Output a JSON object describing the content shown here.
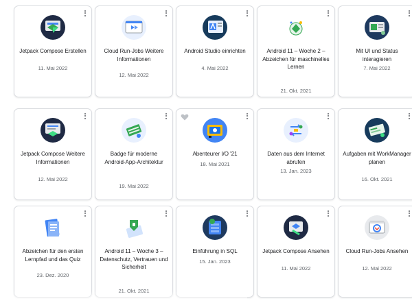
{
  "cards": [
    {
      "title": "Jetpack Compose Erstellen",
      "date": "11. Mai 2022",
      "badge": "compose-badge-icon"
    },
    {
      "title": "Cloud Run-Jobs Weitere Informationen",
      "date": "12. Mai 2022",
      "badge": "cloud-run-badge-icon"
    },
    {
      "title": "Android Studio einrichten",
      "date": "4. Mai 2022",
      "badge": "android-studio-badge-icon"
    },
    {
      "title": "Android 11 – Woche 2 – Abzeichen für maschinelles Lernen",
      "date": "21. Okt. 2021",
      "badge": "ml-badge-icon"
    },
    {
      "title": "Mit UI und Status interagieren",
      "date": "7. Mai 2022",
      "badge": "ui-state-badge-icon"
    },
    {
      "title": "Jetpack Compose Weitere Informationen",
      "date": "12. Mai 2022",
      "badge": "compose-more-badge-icon"
    },
    {
      "title": "Badge für moderne Android-App-Architektur",
      "date": "19. Mai 2022",
      "badge": "architecture-badge-icon"
    },
    {
      "title": "Abenteurer I/O '21",
      "date": "18. Mai 2021",
      "badge": "io-adventurer-badge-icon"
    },
    {
      "title": "Daten aus dem Internet abrufen",
      "date": "13. Jan. 2023",
      "badge": "internet-data-badge-icon"
    },
    {
      "title": "Aufgaben mit WorkManager planen",
      "date": "16. Okt. 2021",
      "badge": "workmanager-badge-icon"
    },
    {
      "title": "Abzeichen für den ersten Lernpfad und das Quiz",
      "date": "23. Dez. 2020",
      "badge": "first-pathway-badge-icon"
    },
    {
      "title": "Android 11 – Woche 3 – Datenschutz, Vertrauen und Sicherheit",
      "date": "21. Okt. 2021",
      "badge": "privacy-badge-icon"
    },
    {
      "title": "Einführung in SQL",
      "date": "15. Jan. 2023",
      "badge": "sql-badge-icon"
    },
    {
      "title": "Jetpack Compose Ansehen",
      "date": "11. Mai 2022",
      "badge": "compose-view-badge-icon"
    },
    {
      "title": "Cloud Run-Jobs Ansehen",
      "date": "12. Mai 2022",
      "badge": "cloud-run-view-badge-icon"
    }
  ],
  "colors": {
    "border": "#dadce0",
    "title": "#202124",
    "date": "#5f6368"
  }
}
